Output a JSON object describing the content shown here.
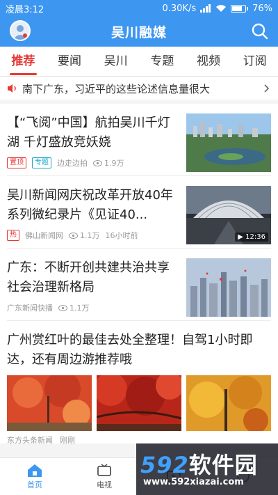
{
  "status_bar": {
    "time": "凌晨3:12",
    "network_speed": "0.30K/s",
    "battery": "76%",
    "battery_level": 0.76
  },
  "header": {
    "title": "吴川融媒"
  },
  "tabs": [
    {
      "label": "推荐",
      "active": true
    },
    {
      "label": "要闻"
    },
    {
      "label": "吴川"
    },
    {
      "label": "专题"
    },
    {
      "label": "视频"
    },
    {
      "label": "订阅"
    }
  ],
  "notice": {
    "text": "南下广东，习近平的这些论述信息量很大"
  },
  "news": [
    {
      "title": "【“飞阅”中国】航拍吴川千灯湖 千灯盛放竞妖娆",
      "tags": [
        "置顶",
        "专题"
      ],
      "source": "边走边拍",
      "views": "1.9万",
      "time": ""
    },
    {
      "title": "吴川新闻网庆祝改革开放40年系列微纪录片《见证40...",
      "tags": [
        "热"
      ],
      "source": "佛山新闻网",
      "views": "1.1万",
      "time": "16小时前",
      "duration": "12:36"
    },
    {
      "title": "广东：不断开创共建共治共享社会治理新格局",
      "tags": [],
      "source": "广东新闻快播",
      "views": "1.1万",
      "time": ""
    }
  ],
  "gallery_news": {
    "title": "广州赏红叶的最佳去处全整理！自驾1小时即达，还有周边游推荐哦",
    "source": "东方头条新闻",
    "time": "刚刚"
  },
  "bottom_nav": [
    {
      "label": "首页",
      "icon": "home-icon",
      "active": true
    },
    {
      "label": "电视",
      "icon": "tv-icon"
    },
    {
      "label": "",
      "icon": "video-icon"
    },
    {
      "label": "",
      "icon": "user-icon"
    }
  ],
  "watermark": {
    "logo_num": "592",
    "logo_text": "软件园",
    "url": "www.592xiazai.com"
  },
  "colors": {
    "primary": "#3d96f0",
    "accent": "#e53935",
    "tag_cyan": "#1ea7c8"
  }
}
